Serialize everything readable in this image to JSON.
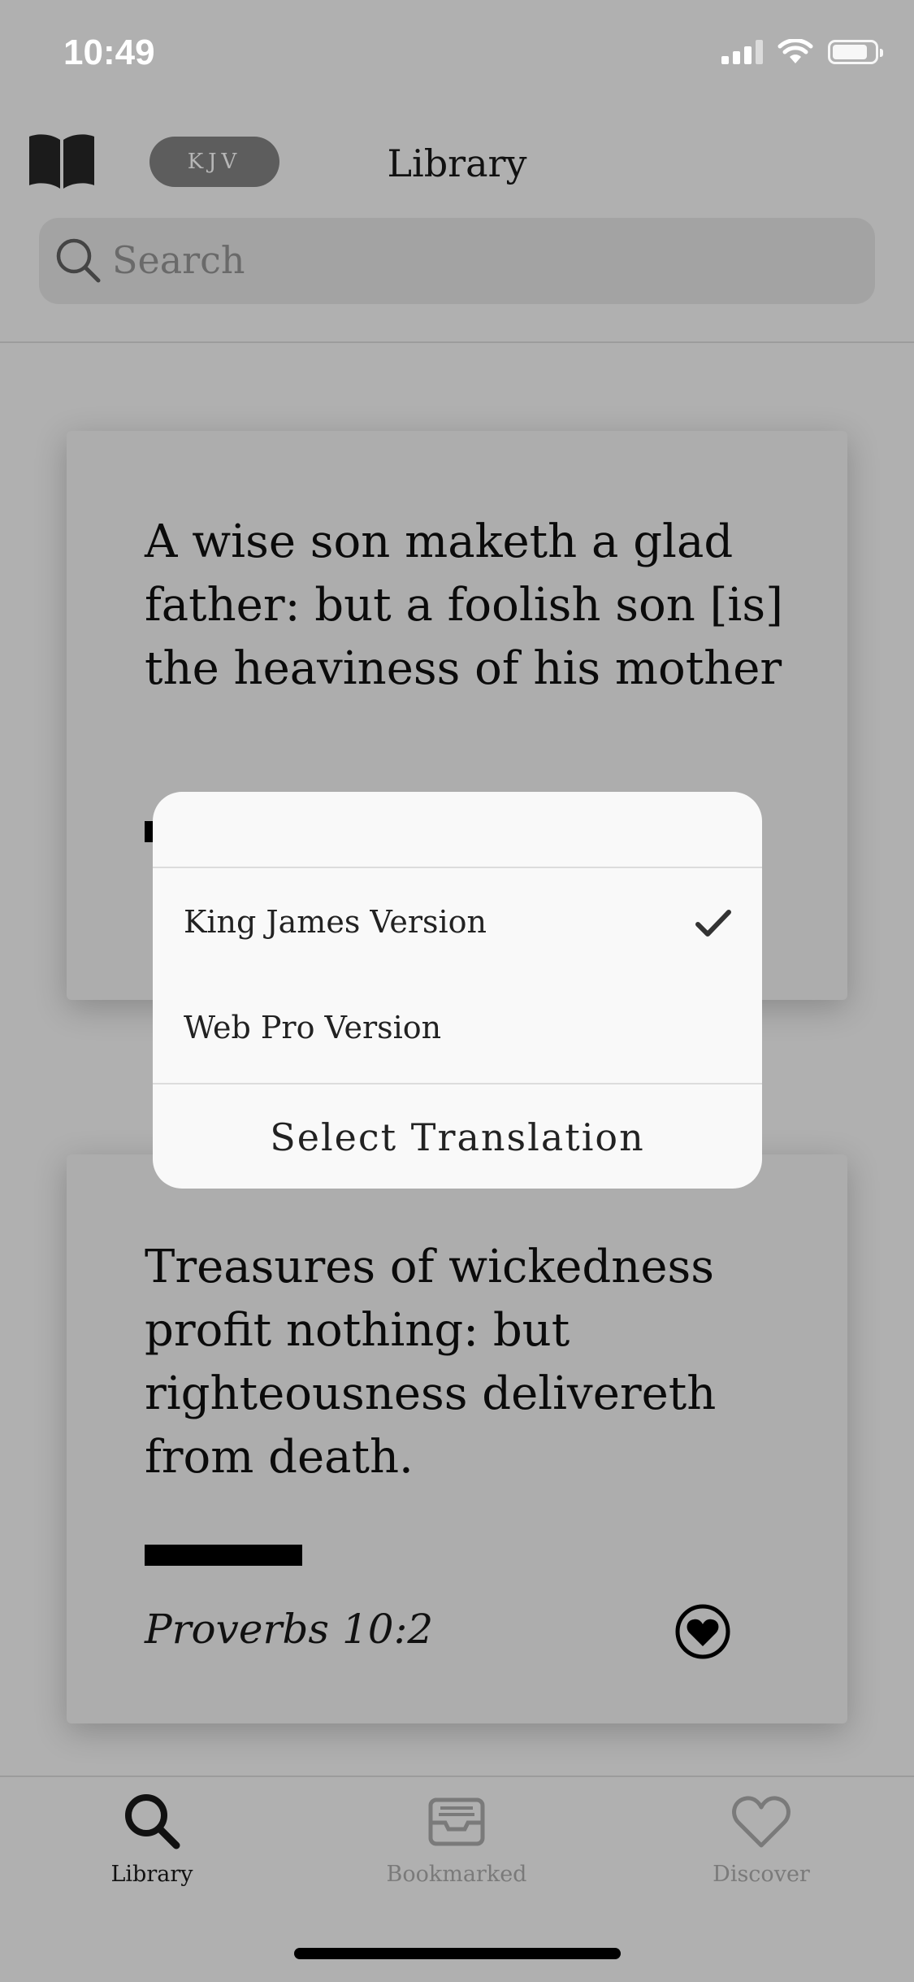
{
  "status_bar": {
    "time": "10:49",
    "icons": [
      "cellular-signal-icon",
      "wifi-icon",
      "battery-icon"
    ]
  },
  "header": {
    "translation_badge": "KJV",
    "title": "Library"
  },
  "search": {
    "placeholder": "Search"
  },
  "cards": [
    {
      "text": "A wise son maketh a glad father: but a foolish son [is] the heaviness of his mother",
      "reference": ""
    },
    {
      "text": "Treasures of wickedness profit nothing: but righteousness delivereth from death.",
      "reference": "Proverbs 10:2"
    }
  ],
  "translation_sheet": {
    "options": [
      {
        "label": "King James Version",
        "selected": true
      },
      {
        "label": "Web Pro Version",
        "selected": false
      }
    ],
    "title": "Select Translation"
  },
  "tab_bar": {
    "items": [
      {
        "label": "Library",
        "icon": "search-icon",
        "active": true
      },
      {
        "label": "Bookmarked",
        "icon": "inbox-tray-icon",
        "active": false
      },
      {
        "label": "Discover",
        "icon": "heart-icon",
        "active": false
      }
    ]
  },
  "colors": {
    "background": "#b0b0b0",
    "card": "#adadad",
    "sheet": "#f9f9f9",
    "badge": "#5d5d5d"
  }
}
